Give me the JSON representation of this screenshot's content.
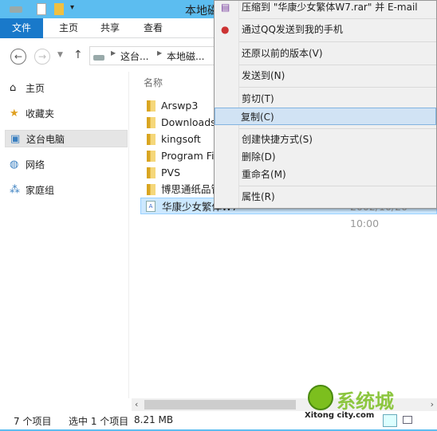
{
  "window": {
    "title": "本地磁",
    "accent": "#5cbdf0"
  },
  "ribbon": {
    "tabs": [
      "文件",
      "主页",
      "共享",
      "查看"
    ]
  },
  "address": {
    "segments": [
      "这台...",
      "本地磁..."
    ]
  },
  "nav": {
    "items": [
      {
        "label": "主页",
        "icon": "home-icon"
      },
      {
        "label": "收藏夹",
        "icon": "star-icon"
      },
      {
        "label": "这台电脑",
        "icon": "computer-icon",
        "selected": true
      },
      {
        "label": "网络",
        "icon": "network-icon"
      },
      {
        "label": "家庭组",
        "icon": "homegroup-icon"
      }
    ]
  },
  "list": {
    "header": "名称",
    "rows": [
      {
        "name": "Arswp3",
        "type": "folder"
      },
      {
        "name": "Downloads",
        "type": "folder"
      },
      {
        "name": "kingsoft",
        "type": "folder"
      },
      {
        "name": "Program Fi",
        "type": "folder"
      },
      {
        "name": "PVS",
        "type": "folder"
      },
      {
        "name": "博思通纸品管",
        "type": "folder"
      },
      {
        "name": "华康少女繁体W7",
        "type": "file",
        "date": "2002/10/20 10:00",
        "selected": true
      }
    ]
  },
  "menu": {
    "items": [
      "压缩到 \"华康少女繁体W7.rar\" 并 E-mail",
      "通过QQ发送到我的手机",
      "还原以前的版本(V)",
      "发送到(N)",
      "剪切(T)",
      "复制(C)",
      "创建快捷方式(S)",
      "删除(D)",
      "重命名(M)",
      "属性(R)"
    ],
    "highlighted": "复制(C)"
  },
  "status": {
    "count": "7 个项目",
    "selection": "选中 1 个项目",
    "size": "8.21 MB"
  },
  "watermark": {
    "text": "系统城",
    "sub": "Xitong city.com"
  }
}
